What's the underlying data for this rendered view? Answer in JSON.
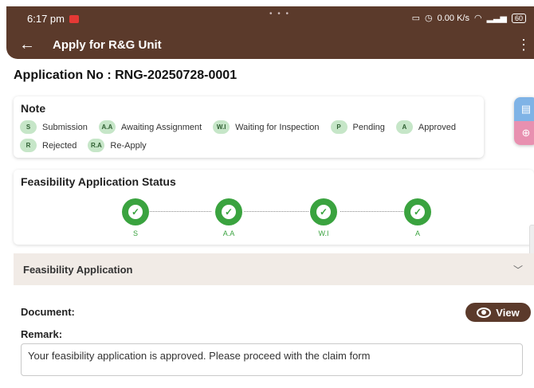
{
  "status_bar": {
    "time": "6:17 pm",
    "net_speed": "0.00 K/s",
    "battery": "60"
  },
  "app_bar": {
    "title": "Apply for R&G Unit",
    "back": "←",
    "menu": "⋮"
  },
  "application": {
    "label": "Application No :",
    "number": "RNG-20250728-0001"
  },
  "note": {
    "title": "Note",
    "row1": [
      {
        "code": "S",
        "label": "Submission"
      },
      {
        "code": "A.A",
        "label": "Awaiting Assignment"
      },
      {
        "code": "W.I",
        "label": "Waiting for Inspection"
      },
      {
        "code": "P",
        "label": "Pending"
      },
      {
        "code": "A",
        "label": "Approved"
      }
    ],
    "row2": [
      {
        "code": "R",
        "label": "Rejected"
      },
      {
        "code": "R.A",
        "label": "Re-Apply"
      }
    ]
  },
  "feasibility_status": {
    "title": "Feasibility Application Status",
    "steps": [
      {
        "label": "S"
      },
      {
        "label": "A.A"
      },
      {
        "label": "W.I"
      },
      {
        "label": "A"
      }
    ]
  },
  "accordion": {
    "title": "Feasibility Application"
  },
  "document": {
    "doc_label": "Document:",
    "view_label": "View",
    "remark_label": "Remark:",
    "remark_text": "Your feasibility application is approved. Please proceed with the claim form"
  },
  "colors": {
    "brand": "#5b3a2b",
    "success": "#3aa33f",
    "badge_bg": "#c6e6c8"
  },
  "icons": [
    "back-arrow-icon",
    "more-vert-icon",
    "check-icon",
    "eye-icon",
    "chevron-down-icon",
    "mail-icon"
  ]
}
